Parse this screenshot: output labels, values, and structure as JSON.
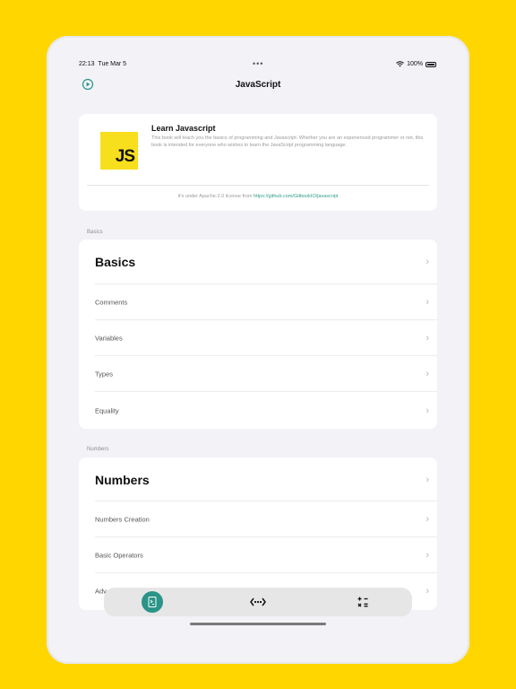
{
  "status_bar": {
    "time": "22:13",
    "date": "Tue Mar 5",
    "battery": "100%"
  },
  "nav": {
    "title": "JavaScript",
    "left_icon": "play-circle-icon"
  },
  "intro": {
    "logo_text": "JS",
    "title": "Learn Javascript",
    "description": "This book will teach you the basics of programming and Javascript. Whether you are an experienced programmer or not, this book is intended for everyone who wishes to learn the JavaScript programming language.",
    "license_prefix": "It's under Apache-2.0 license from ",
    "license_link": "https://github.com/GitbookIO/javascript"
  },
  "sections": [
    {
      "header": "Basics",
      "heading_row": "Basics",
      "items": [
        "Comments",
        "Variables",
        "Types",
        "Equality"
      ]
    },
    {
      "header": "Numbers",
      "heading_row": "Numbers",
      "items": [
        "Numbers Creation",
        "Basic Operators",
        "Adv"
      ]
    }
  ],
  "tabs": [
    {
      "icon": "terminal-book-icon",
      "active": true
    },
    {
      "icon": "code-brackets-icon",
      "active": false
    },
    {
      "icon": "calculator-icon",
      "active": false
    }
  ],
  "colors": {
    "background": "#FFD600",
    "accent": "#2b9488",
    "js_yellow": "#F7DF1E"
  }
}
